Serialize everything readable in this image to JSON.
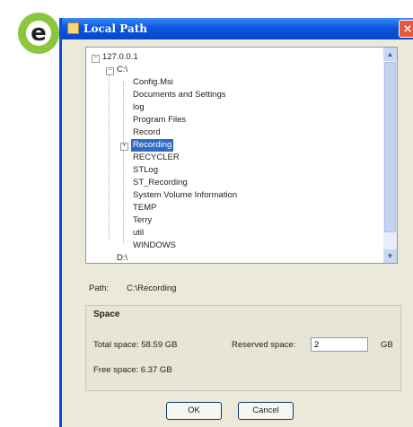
{
  "dialog": {
    "title": "Local Path",
    "close_label": "×"
  },
  "badge": {
    "letter": "e"
  },
  "tree": {
    "root": "127.0.0.1",
    "drive_c": "C:\\",
    "folders": [
      "Config.Msi",
      "Documents and Settings",
      "log",
      "Program Files",
      "Record",
      "Recording",
      "RECYCLER",
      "STLog",
      "ST_Recording",
      "System Volume Information",
      "TEMP",
      "Terry",
      "util",
      "WINDOWS"
    ],
    "selected_folder": "Recording",
    "drive_d": "D:\\"
  },
  "path": {
    "label": "Path:",
    "value": "C:\\Recording"
  },
  "space": {
    "title": "Space",
    "total": "Total space: 58.59 GB",
    "free": "Free space: 6.37 GB",
    "reserved_label": "Reserved space:",
    "reserved_value": "2",
    "reserved_unit": "GB"
  },
  "buttons": {
    "ok": "OK",
    "cancel": "Cancel"
  },
  "colors": {
    "badge": "#8cc63f",
    "titlebar": "#0c55e0",
    "selection": "#316ac5",
    "dialog_bg": "#ece9d8"
  }
}
